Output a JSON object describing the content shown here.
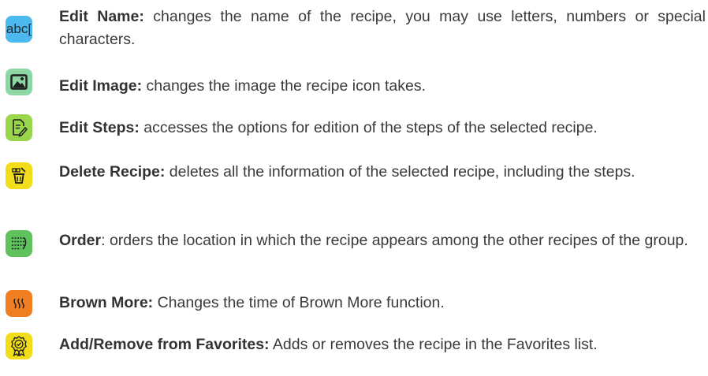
{
  "items": [
    {
      "icon": "text-cursor-icon",
      "icon_text": "abc",
      "color": "#4bb8f0",
      "title": "Edit Name:",
      "description": " changes the name of the recipe, you may use letters, numbers or special characters."
    },
    {
      "icon": "image-icon",
      "color": "#8fd6a5",
      "title": "Edit Image:",
      "description": " changes the image the recipe icon takes."
    },
    {
      "icon": "edit-document-icon",
      "color": "#9ad64b",
      "title": "Edit Steps:",
      "description": " accesses the options for edition of the steps of the selected recipe."
    },
    {
      "icon": "delete-recipe-icon",
      "color": "#f2dd1a",
      "title": "Delete Recipe:",
      "description": " deletes all the information of the selected recipe, including the steps."
    },
    {
      "icon": "order-list-icon",
      "color": "#5fc25f",
      "title": "Order",
      "description": ": orders the location in which the recipe appears among the other recipes of the group."
    },
    {
      "icon": "heat-waves-icon",
      "color": "#f07f24",
      "title": "Brown More:",
      "description": " Changes the time of Brown More function."
    },
    {
      "icon": "award-ribbon-icon",
      "color": "#f2dd1a",
      "title": "Add/Remove from Favorites:",
      "description": " Adds or removes the recipe in the Favorites list."
    }
  ]
}
